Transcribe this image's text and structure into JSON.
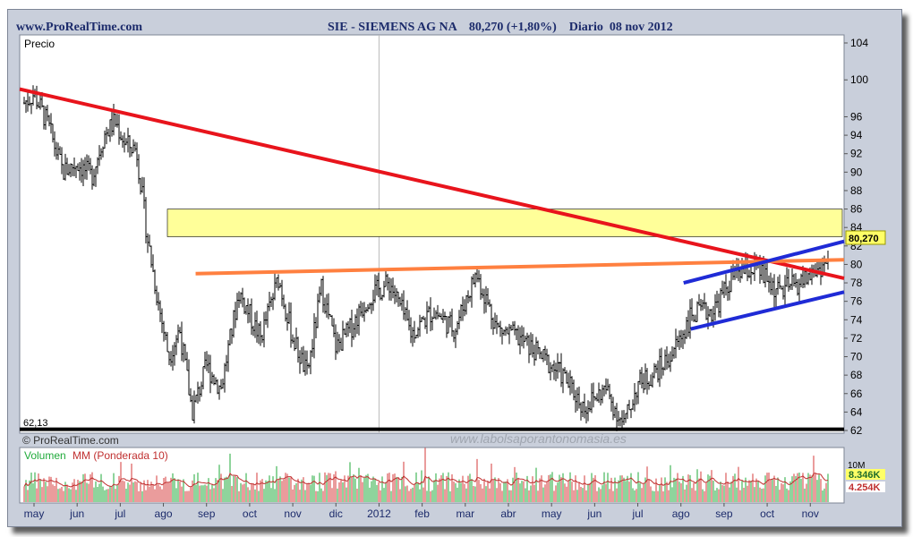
{
  "header": {
    "site": "www.ProRealTime.com",
    "title": "SIE - SIEMENS AG NA    80,270 (+1,80%)    Diario  08 nov 2012"
  },
  "price_panel": {
    "label": "Precio",
    "low_label": "62,13",
    "last_price_label": "80,270",
    "copyright": "© ProRealTime.com",
    "watermark": "www.labolsaporantonomasia.es"
  },
  "volume_panel": {
    "label_prefix": "Volumen",
    "label_mm": "MM (Ponderada 10)",
    "top_label": "10M",
    "label_volume": "8.346K",
    "label_mm_value": "4.254K"
  },
  "colors": {
    "background": "#c9cfdb",
    "plot_bg": "#ffffff",
    "trend_down": "#e8141c",
    "resistance": "#ff8040",
    "channel": "#1f2bd6",
    "zone_fill": "#ffff99",
    "support": "#000000",
    "volume_up": "#1faa3a",
    "volume_down": "#d63a3a",
    "mm_line": "#c03030",
    "text": "#1c2b6b"
  },
  "chart_data": {
    "type": "candlestick",
    "title": "SIE - SIEMENS AG NA 80,270 (+1,80%) Diario 08 nov 2012",
    "ylabel": "Precio",
    "ylim": [
      62,
      104
    ],
    "y_ticks": [
      104,
      100,
      96,
      94,
      92,
      90,
      88,
      86,
      84,
      82,
      80,
      78,
      76,
      74,
      72,
      70,
      68,
      66,
      64,
      62
    ],
    "x_tick_labels": [
      "may",
      "jun",
      "jul",
      "ago",
      "sep",
      "oct",
      "nov",
      "dic",
      "2012",
      "feb",
      "mar",
      "abr",
      "may",
      "jun",
      "jul",
      "ago",
      "sep",
      "oct",
      "nov"
    ],
    "price_path": [
      [
        "may",
        97.5
      ],
      [
        "may",
        98.5
      ],
      [
        "may",
        95
      ],
      [
        "jun",
        90
      ],
      [
        "jun",
        91
      ],
      [
        "jun",
        89.5
      ],
      [
        "jul",
        94
      ],
      [
        "jul",
        95.5
      ],
      [
        "jul",
        93
      ],
      [
        "jul",
        92.5
      ],
      [
        "ago",
        83
      ],
      [
        "ago",
        76
      ],
      [
        "ago",
        70
      ],
      [
        "ago",
        73
      ],
      [
        "sep",
        64
      ],
      [
        "sep",
        69
      ],
      [
        "sep",
        66.5
      ],
      [
        "oct",
        77
      ],
      [
        "oct",
        72
      ],
      [
        "nov",
        78.5
      ],
      [
        "nov",
        72
      ],
      [
        "nov",
        68
      ],
      [
        "dic",
        77.5
      ],
      [
        "dic",
        71
      ],
      [
        "dic",
        73
      ],
      [
        "2012",
        76.5
      ],
      [
        "2012",
        78
      ],
      [
        "feb",
        72.5
      ],
      [
        "feb",
        75
      ],
      [
        "mar",
        73
      ],
      [
        "mar",
        79
      ],
      [
        "abr",
        73
      ],
      [
        "abr",
        72
      ],
      [
        "may",
        70
      ],
      [
        "may",
        68
      ],
      [
        "jun",
        64.5
      ],
      [
        "jun",
        66.5
      ],
      [
        "jul",
        62.5
      ],
      [
        "jul",
        67
      ],
      [
        "jul",
        68
      ],
      [
        "ago",
        70
      ],
      [
        "ago",
        74.5
      ],
      [
        "sep",
        75
      ],
      [
        "sep",
        79
      ],
      [
        "oct",
        79.5
      ],
      [
        "oct",
        77
      ],
      [
        "nov",
        78
      ],
      [
        "nov",
        80.27
      ]
    ],
    "overlays": {
      "downtrend_line": {
        "start": [
          "may",
          99
        ],
        "end": [
          "nov",
          78.5
        ]
      },
      "resistance_line": {
        "start": [
          "ago",
          79
        ],
        "end": [
          "nov",
          80.5
        ]
      },
      "resistance_zone": {
        "from": 83,
        "to": 86
      },
      "channel_upper": {
        "start": [
          "ago",
          78
        ],
        "end": [
          "nov",
          82.5
        ]
      },
      "channel_lower": {
        "start": [
          "ago",
          73
        ],
        "end": [
          "nov",
          77
        ]
      },
      "support_line": 62.13
    },
    "last_price": 80.27,
    "change_percent": 1.8,
    "date": "08 nov 2012",
    "volume": {
      "label": "Volumen MM (Ponderada 10)",
      "last_volume": "8.346K",
      "mm": "4.254K"
    }
  }
}
